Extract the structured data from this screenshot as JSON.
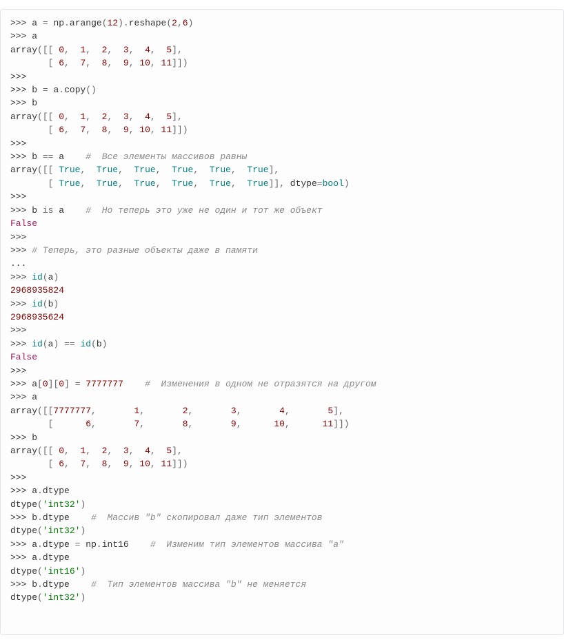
{
  "prompts": {
    "ps1": ">>>",
    "ps2": "..."
  },
  "builtins": {
    "id": "id",
    "bool": "bool",
    "True": "True",
    "False": "False",
    "dtype_kw": "dtype"
  },
  "vars": {
    "a": "a",
    "b": "b",
    "np": "np",
    "arange": "arange",
    "reshape": "reshape",
    "copy": "copy",
    "int16": "int16",
    "dtype": "dtype"
  },
  "nums": {
    "n12": "12",
    "n2": "2",
    "n6": "6",
    "n0": "0",
    "n1": "1",
    "n3": "3",
    "n4": "4",
    "n5": "5",
    "n7": "7",
    "n8": "8",
    "n9": "9",
    "n10": "10",
    "n11": "11",
    "big": "7777777",
    "id_a": "2968935824",
    "id_b": "2968935624"
  },
  "strings": {
    "int32": "'int32'",
    "int16": "'int16'"
  },
  "tokens": {
    "array": "array",
    "is": "is"
  },
  "comments": {
    "c1": "#  Все элементы массивов равны",
    "c2": "#  Но теперь это уже не один и тот же объект",
    "c3": "# Теперь, это разные объекты даже в памяти",
    "c4": "#  Изменения в одном не отразятся на другом",
    "c5": "#  Массив \"b\" скопировал даже тип элементов",
    "c6": "#  Изменим тип элементов массива \"a\"",
    "c7": "#  Тип элементов массива \"b\" не меняется"
  },
  "output_rows": {
    "row1": "array([[ 0,  1,  2,  3,  4,  5],",
    "row2": "       [ 6,  7,  8,  9, 10, 11]])",
    "trues1": "array([[ True,  True,  True,  True,  True,  True],",
    "trues2": "       [ True,  True,  True,  True,  True,  True]], dtype=bool)",
    "big1": "array([[7777777,       1,       2,       3,       4,       5],",
    "big2": "       [      6,       7,       8,       9,      10,      11]])",
    "dtype_int32": "dtype('int32')",
    "dtype_int16": "dtype('int16')"
  }
}
